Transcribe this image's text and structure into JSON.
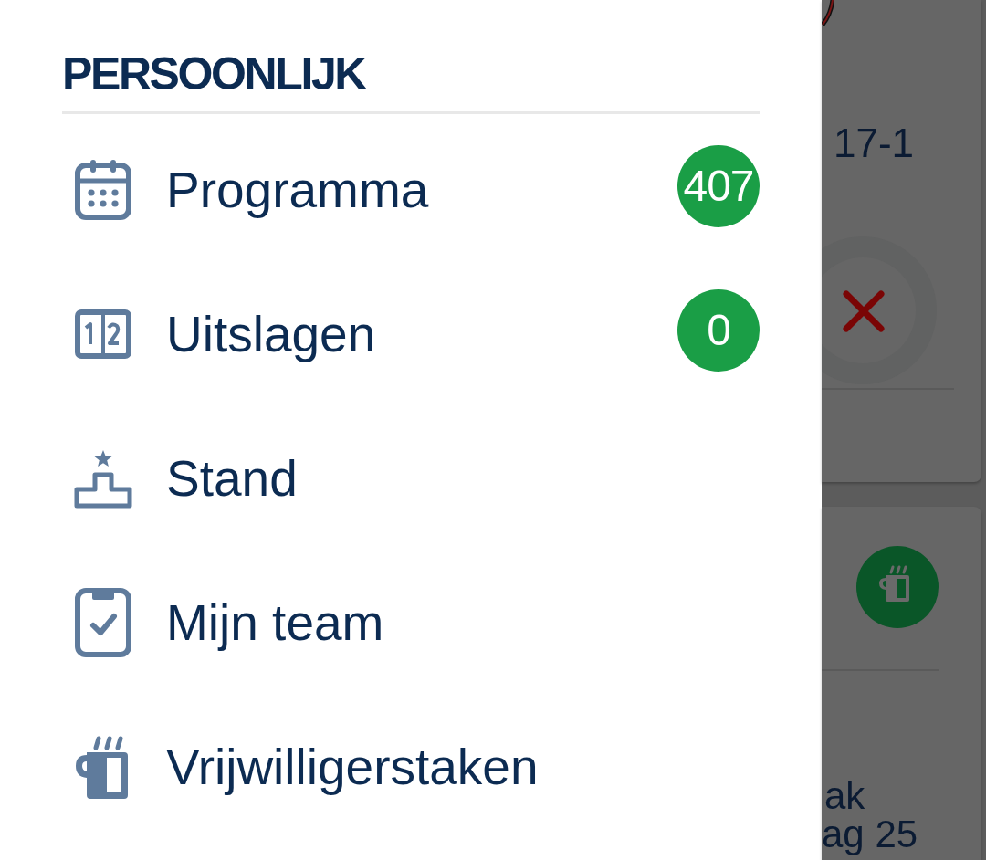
{
  "drawer": {
    "section_title": "PERSOONLIJK",
    "items": [
      {
        "label": "Programma",
        "badge": "407"
      },
      {
        "label": "Uitslagen",
        "badge": "0"
      },
      {
        "label": "Stand"
      },
      {
        "label": "Mijn team"
      },
      {
        "label": "Vrijwilligerstaken"
      }
    ]
  },
  "background": {
    "top_card": {
      "text": "17-1"
    },
    "bottom_card": {
      "text_lines": [
        "ak",
        "ag 25"
      ]
    }
  }
}
